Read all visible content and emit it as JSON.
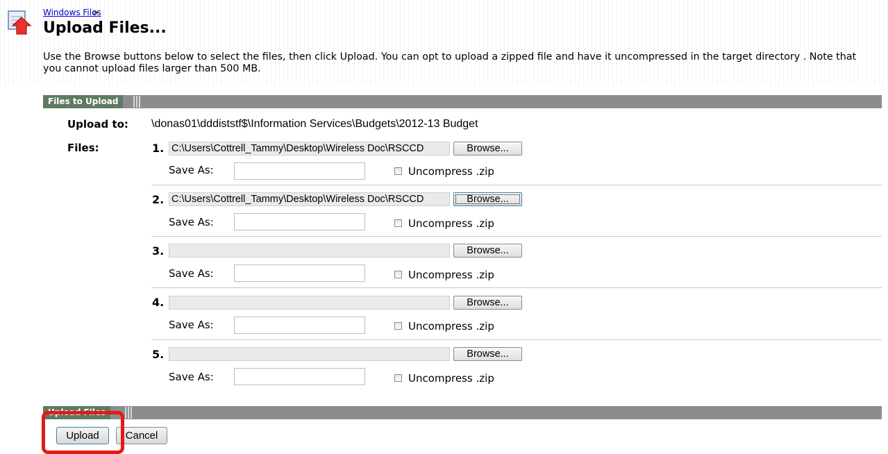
{
  "breadcrumb": {
    "link": "Windows Files",
    "separator": ">"
  },
  "page_title": "Upload Files...",
  "intro_text": "Use the Browse buttons below to select the files, then click Upload. You can opt to upload a zipped file and have it uncompressed in the target directory . Note that you cannot upload files larger than 500 MB.",
  "files_section": {
    "tab_label": "Files to Upload"
  },
  "upload_to": {
    "label": "Upload to:",
    "path": "\\donas01\\dddiststf$\\Information Services\\Budgets\\2012-13 Budget"
  },
  "files_label": "Files:",
  "file_rows": [
    {
      "number": "1.",
      "value": "C:\\Users\\Cottrell_Tammy\\Desktop\\Wireless Doc\\RSCCD",
      "browse": "Browse...",
      "save_as": "Save As:",
      "uncompress": "Uncompress .zip"
    },
    {
      "number": "2.",
      "value": "C:\\Users\\Cottrell_Tammy\\Desktop\\Wireless Doc\\RSCCD",
      "browse": "Browse...",
      "save_as": "Save As:",
      "uncompress": "Uncompress .zip"
    },
    {
      "number": "3.",
      "value": "",
      "browse": "Browse...",
      "save_as": "Save As:",
      "uncompress": "Uncompress .zip"
    },
    {
      "number": "4.",
      "value": "",
      "browse": "Browse...",
      "save_as": "Save As:",
      "uncompress": "Uncompress .zip"
    },
    {
      "number": "5.",
      "value": "",
      "browse": "Browse...",
      "save_as": "Save As:",
      "uncompress": "Uncompress .zip"
    }
  ],
  "upload_section": {
    "tab_label": "Upload Files"
  },
  "actions": {
    "upload": "Upload",
    "cancel": "Cancel"
  },
  "colors": {
    "section_tab": "#5e7a63",
    "section_bar": "#8c8c8c",
    "highlight": "#e41b17",
    "link": "#0000cc"
  },
  "icons": {
    "header": "upload-folder-icon"
  }
}
